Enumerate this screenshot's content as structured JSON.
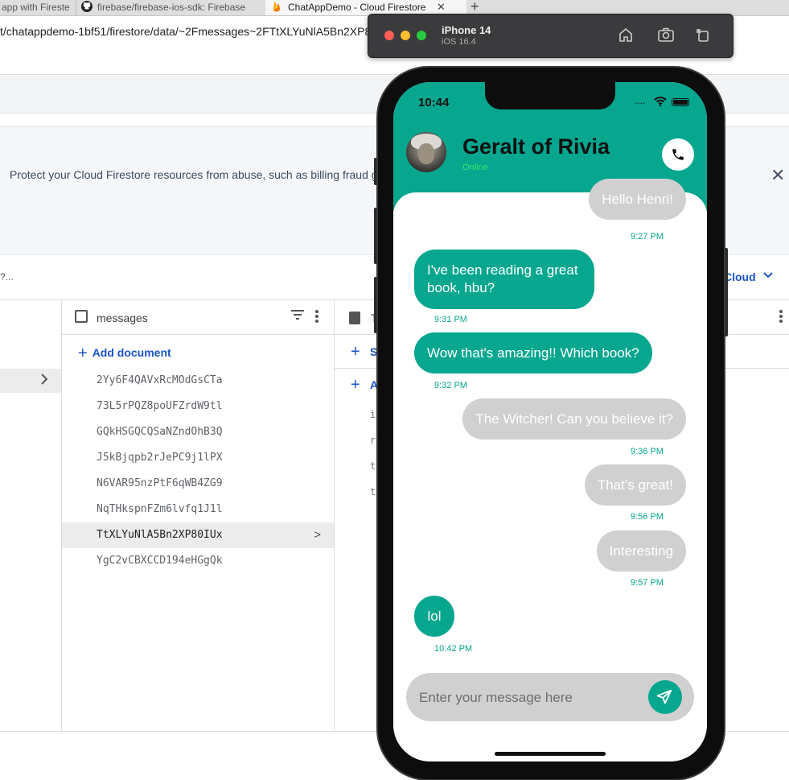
{
  "browser": {
    "tabs": [
      {
        "label": "app with Fireste"
      },
      {
        "label": "firebase/firebase-ios-sdk: Firebase"
      },
      {
        "label": "ChatAppDemo - Cloud Firestore"
      }
    ],
    "close_glyph": "✕",
    "new_tab_glyph": "+",
    "url": "t/chatappdemo-1bf51/firestore/data/~2Fmessages~2FTtXLYuNlA5Bn2XP80IUx"
  },
  "console": {
    "banner_text": "Protect your Cloud Firestore resources from abuse, such as billing fraud g",
    "banner_close": "✕",
    "breadcrumb_fragment": "?...",
    "cloud_link": "Cloud",
    "collection": {
      "title": "messages",
      "add_label": "Add document",
      "add_glyph": "+",
      "documents": [
        "2Yy6F4QAVxRcMOdGsCTa",
        "73L5rPQZ8poUFZrdW9tl",
        "GQkHSGQCQSaNZndOhB3Q",
        "J5kBjqpb2rJePC9j1lPX",
        "N6VAR95nzPtF6qWB4ZG9",
        "NqTHkspnFZm6lvfq1J1l",
        "TtXLYuNlA5Bn2XP80IUx",
        "YgC2vCBXCCD194eHGgQk"
      ],
      "selected_index": 6
    },
    "doc_pane": {
      "col_header_fragment": "T",
      "start_collection_fragment": "S",
      "add_field_fragment": "A",
      "field_fragments": [
        "i",
        "r",
        "t",
        "t"
      ]
    }
  },
  "simulator": {
    "device_name": "iPhone 14",
    "os_version": "iOS 16.4",
    "icons": [
      "home-icon",
      "screenshot-icon",
      "rotate-icon"
    ]
  },
  "phone": {
    "status_time": "10:44",
    "status_dots": "....",
    "contact_name": "Geralt of Rivia",
    "contact_status": "Online",
    "messages": [
      {
        "text": "Hello Henri!",
        "time": "9:27 PM",
        "sender": "other"
      },
      {
        "text": "I've been reading a great book, hbu?",
        "time": "9:31 PM",
        "sender": "me"
      },
      {
        "text": "Wow that's amazing!! Which book?",
        "time": "9:32 PM",
        "sender": "me"
      },
      {
        "text": "The Witcher! Can you believe it?",
        "time": "9:36 PM",
        "sender": "other"
      },
      {
        "text": "That’s great!",
        "time": "9:56 PM",
        "sender": "other"
      },
      {
        "text": "Interesting",
        "time": "9:57 PM",
        "sender": "other"
      },
      {
        "text": "lol",
        "time": "10:42 PM",
        "sender": "me"
      }
    ],
    "input_placeholder": "Enter your message here",
    "colors": {
      "accent": "#06a68f",
      "received_bubble": "#d0d0d0",
      "online": "#2ee86a"
    }
  }
}
